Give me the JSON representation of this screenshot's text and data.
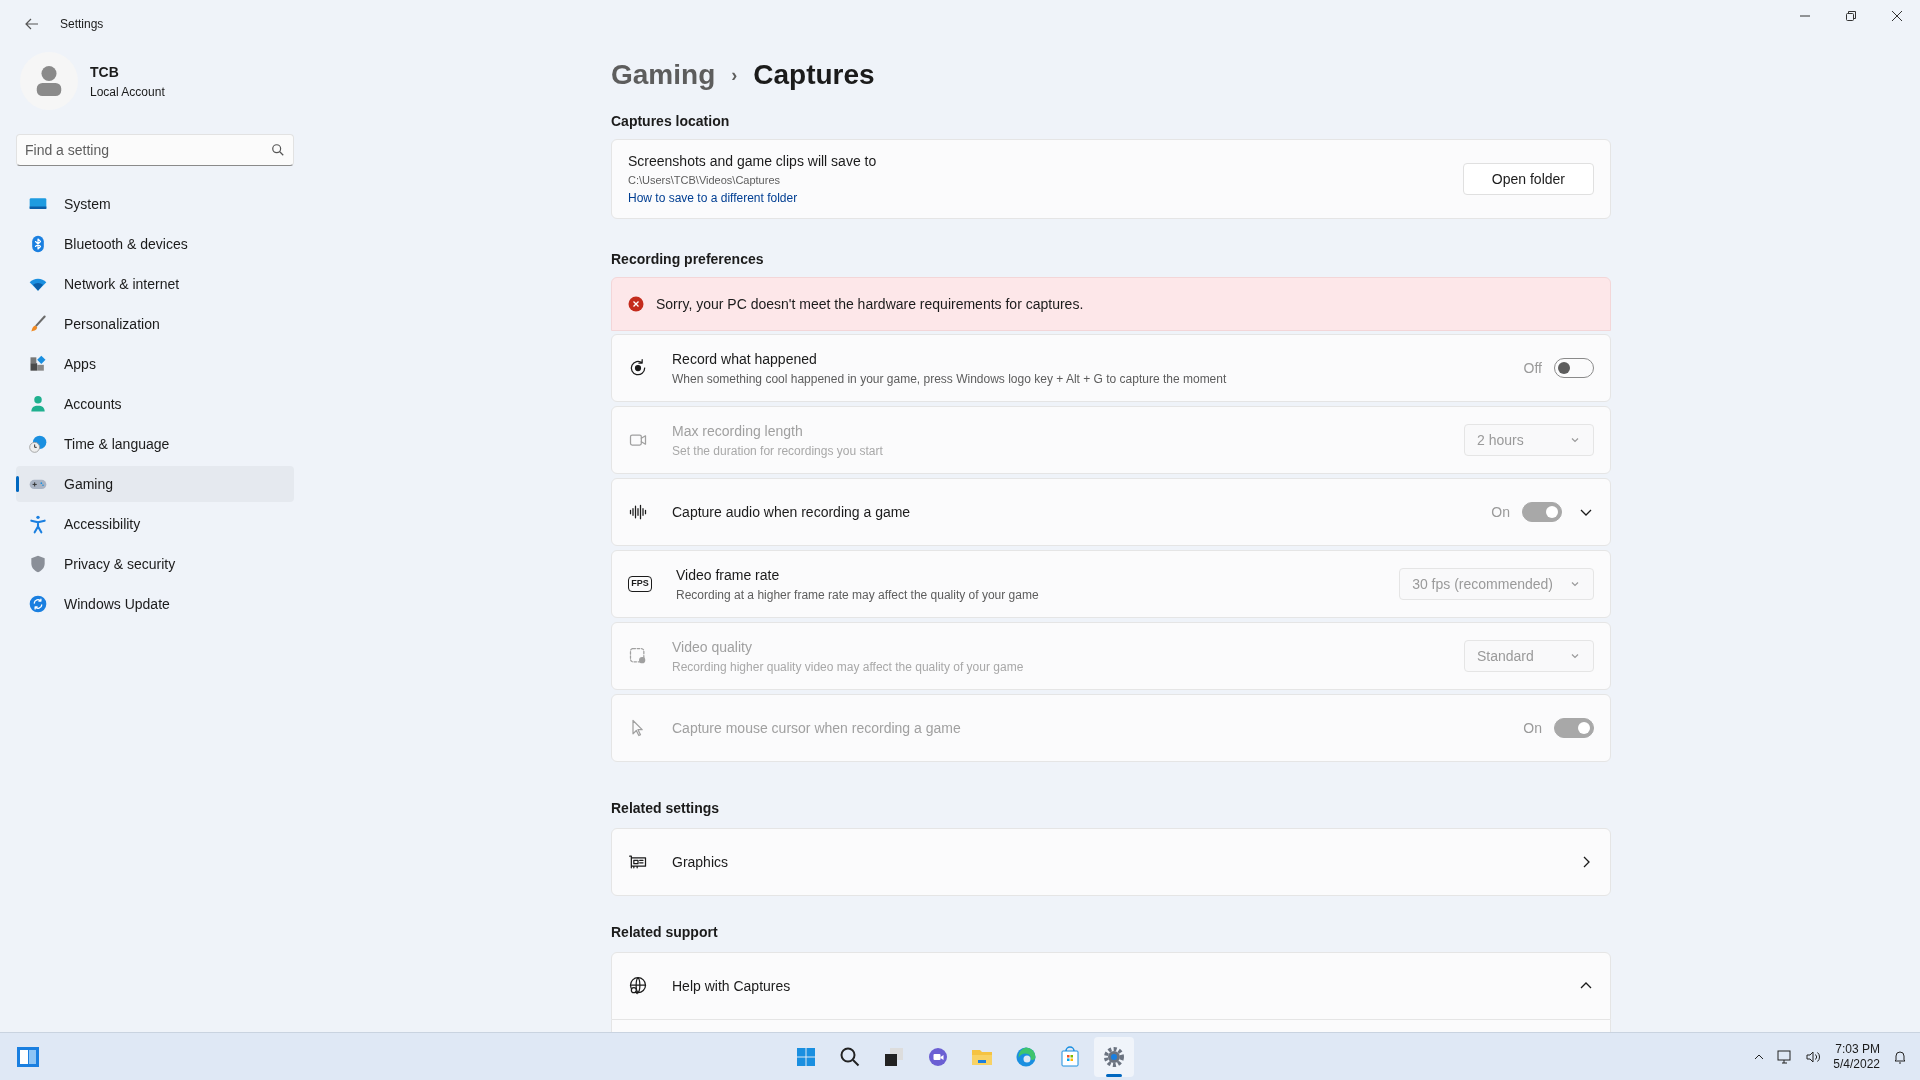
{
  "window": {
    "title": "Settings"
  },
  "account": {
    "name": "TCB",
    "type": "Local Account"
  },
  "search": {
    "placeholder": "Find a setting"
  },
  "sidebar": {
    "items": [
      {
        "label": "System",
        "selected": false
      },
      {
        "label": "Bluetooth & devices",
        "selected": false
      },
      {
        "label": "Network & internet",
        "selected": false
      },
      {
        "label": "Personalization",
        "selected": false
      },
      {
        "label": "Apps",
        "selected": false
      },
      {
        "label": "Accounts",
        "selected": false
      },
      {
        "label": "Time & language",
        "selected": false
      },
      {
        "label": "Gaming",
        "selected": true
      },
      {
        "label": "Accessibility",
        "selected": false
      },
      {
        "label": "Privacy & security",
        "selected": false
      },
      {
        "label": "Windows Update",
        "selected": false
      }
    ]
  },
  "breadcrumb": {
    "parent": "Gaming",
    "separator": "›",
    "current": "Captures"
  },
  "captures_location": {
    "heading": "Captures location",
    "title": "Screenshots and game clips will save to",
    "path": "C:\\Users\\TCB\\Videos\\Captures",
    "link": "How to save to a different folder",
    "button": "Open folder"
  },
  "recording_preferences": {
    "heading": "Recording preferences",
    "error": "Sorry, your PC doesn't meet the hardware requirements for captures.",
    "rows": [
      {
        "title": "Record what happened",
        "description": "When something cool happened in your game, press Windows logo key + Alt + G to capture the moment",
        "disabled": false,
        "control": {
          "kind": "toggle",
          "label": "Off",
          "on": false,
          "disabled": false
        }
      },
      {
        "title": "Max recording length",
        "description": "Set the duration for recordings you start",
        "disabled": true,
        "control": {
          "kind": "dropdown",
          "value": "2 hours",
          "disabled": true
        }
      },
      {
        "title": "Capture audio when recording a game",
        "disabled": false,
        "expanded": false,
        "control": {
          "kind": "toggle",
          "label": "On",
          "on": true,
          "disabled": true
        }
      },
      {
        "title": "Video frame rate",
        "icon_text": "FPS",
        "description": "Recording at a higher frame rate may affect the quality of your game",
        "disabled": false,
        "control": {
          "kind": "dropdown",
          "value": "30 fps (recommended)",
          "disabled": true
        }
      },
      {
        "title": "Video quality",
        "description": "Recording higher quality video may affect the quality of your game",
        "disabled": true,
        "control": {
          "kind": "dropdown",
          "value": "Standard",
          "disabled": true
        }
      },
      {
        "title": "Capture mouse cursor when recording a game",
        "disabled": true,
        "control": {
          "kind": "toggle",
          "label": "On",
          "on": true,
          "disabled": true
        }
      }
    ]
  },
  "related_settings": {
    "heading": "Related settings",
    "items": [
      {
        "title": "Graphics"
      }
    ]
  },
  "related_support": {
    "heading": "Related support",
    "items": [
      {
        "title": "Help with Captures",
        "expanded": true
      }
    ]
  },
  "taskbar": {
    "apps": [
      {
        "selected": false
      },
      {
        "selected": false
      },
      {
        "selected": false
      },
      {
        "selected": false
      },
      {
        "selected": false
      },
      {
        "selected": false
      },
      {
        "selected": false
      },
      {
        "selected": true
      }
    ],
    "time": "7:03 PM",
    "date": "5/4/2022"
  }
}
